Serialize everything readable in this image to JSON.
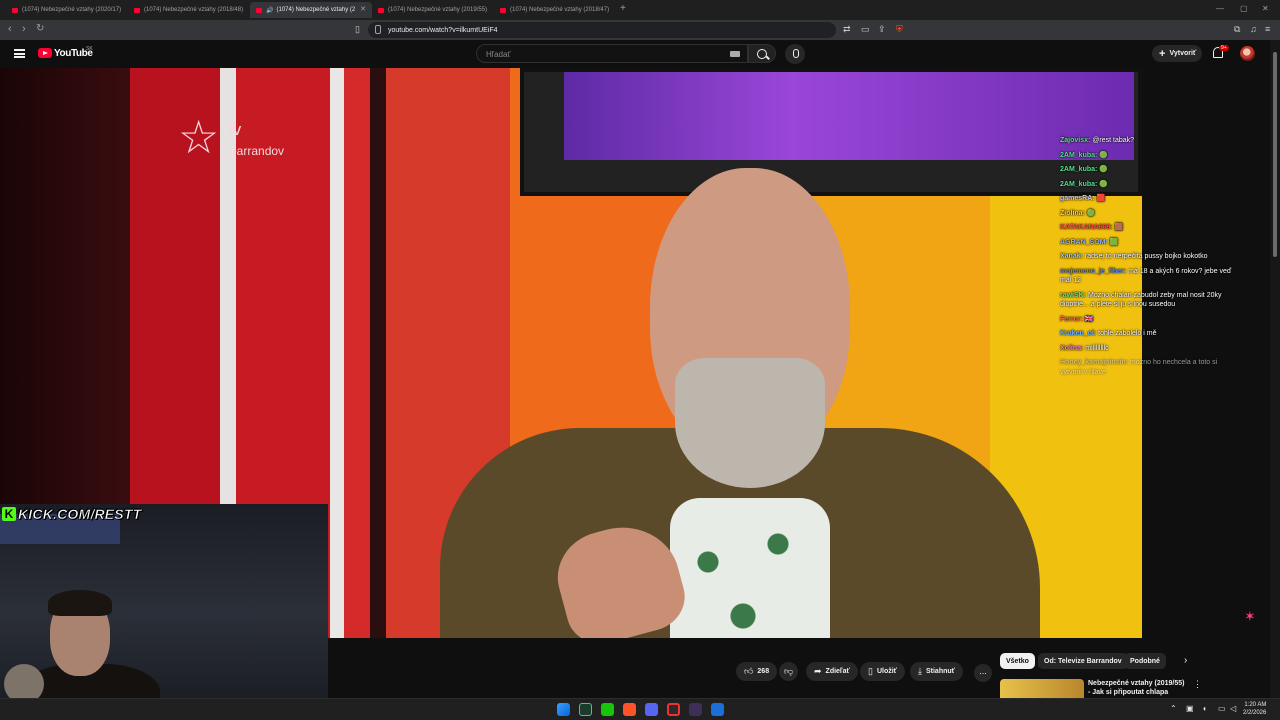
{
  "browser": {
    "tabs": [
      {
        "label": "(1074) Nebezpečné vztahy (2020/17)"
      },
      {
        "label": "(1074) Nebezpečné vztahy (2018/48)"
      },
      {
        "label": "(1074) Nebezpečné vztahy (2"
      },
      {
        "label": "(1074) Nebezpečné vztahy (2019/55)"
      },
      {
        "label": "(1074) Nebezpečné vztahy (2018/47)"
      }
    ],
    "active_tab_index": 2,
    "new_tab_symbol": "+",
    "url": "youtube.com/watch?v=ilkumtUEiF4"
  },
  "youtube": {
    "logo_text": "YouTube",
    "country_code": "SK",
    "search_placeholder": "Hľadať",
    "create_label": "Vytvoriť",
    "notification_count": "9+"
  },
  "video": {
    "channel_logo_tv": "tv",
    "channel_logo_name": "barrandov",
    "stream_overlay": "KICK.COM/RESTT"
  },
  "chat": [
    {
      "user": "Zajovisx:",
      "text": "@rest tabak?",
      "color": "#54e08a",
      "faded": false
    },
    {
      "user": "2AM_kuba:",
      "text": "🟢",
      "color": "#54e08a",
      "faded": false
    },
    {
      "user": "2AM_kuba:",
      "text": "🟢",
      "color": "#54e08a",
      "faded": false
    },
    {
      "user": "2AM_kuba:",
      "text": "🟢",
      "color": "#54e08a",
      "faded": false
    },
    {
      "user": "gamesRA:",
      "text": "🟥",
      "color": "#c9c9ff",
      "faded": false
    },
    {
      "user": "Ziolina:",
      "text": "🟢",
      "color": "#ffd23f",
      "faded": false
    },
    {
      "user": "KATAKANA669:",
      "text": "🟫",
      "color": "#ff4d4d",
      "faded": false
    },
    {
      "user": "AGRAN_SOM:",
      "text": "🟩",
      "color": "#8fb6ff",
      "faded": false
    },
    {
      "user": "Xanak:",
      "text": "radsej to nerpečita pussy bojko kokotko",
      "color": "#8fd3ff",
      "faded": false
    },
    {
      "user": "mojemeno_je_fiber:",
      "text": "má 18 a akých 6 rokov? jebe veď mal 12",
      "color": "#5a8cff",
      "faded": false
    },
    {
      "user": "rawiSK:",
      "text": "Mozno chalan zabudol zeby mal nosit 20ky dioptrie... a plete si ju s inou susedou",
      "color": "#7ee27e",
      "faded": false
    },
    {
      "user": "Ferror:",
      "text": "🇬🇧",
      "color": "#ff6a3d",
      "faded": false
    },
    {
      "user": "Kraken_oi:",
      "text": "tohle zabolelo i mě",
      "color": "#6fb4ff",
      "faded": false
    },
    {
      "user": "Xolina:",
      "text": "mlllllllllc",
      "color": "#ff7ad9",
      "faded": false
    },
    {
      "user": "Honey_kamajoinsin:",
      "text": "mozno ho nechcela a toto si vytvoril v hlave",
      "color": "#bbbbbb",
      "faded": true
    }
  ],
  "actions": {
    "likes": "268",
    "share_label": "Zdieľať",
    "save_label": "Uložiť",
    "download_label": "Stiahnuť",
    "more_symbol": "..."
  },
  "recommendations": {
    "chips": [
      "Všetko",
      "Od: Televize Barrandov",
      "Podobné"
    ],
    "selected_chip_index": 0,
    "first_item_title": "Nebezpečné vztahy (2019/55) - Jak si připoutat chlapa"
  },
  "taskbar": {
    "time": "1:20 AM",
    "date": "2/2/2026"
  },
  "colors": {
    "youtube_red": "#ff0033",
    "kick_green": "#53fc18",
    "page_bg": "#0f0f0f"
  }
}
